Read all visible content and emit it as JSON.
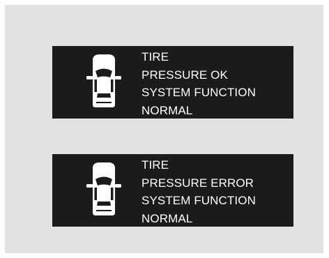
{
  "messages": [
    {
      "id": "tire-pressure-ok",
      "icon": "car-top-view-icon",
      "lines": [
        "TIRE",
        "PRESSURE OK",
        "SYSTEM FUNCTION",
        "NORMAL"
      ]
    },
    {
      "id": "tire-pressure-error",
      "icon": "car-top-view-icon",
      "lines": [
        "TIRE",
        "PRESSURE ERROR",
        "SYSTEM FUNCTION",
        "NORMAL"
      ]
    }
  ],
  "colors": {
    "panel_background": "#e2e2e2",
    "display_background": "#1b1b1b",
    "display_text": "#ffffff"
  }
}
